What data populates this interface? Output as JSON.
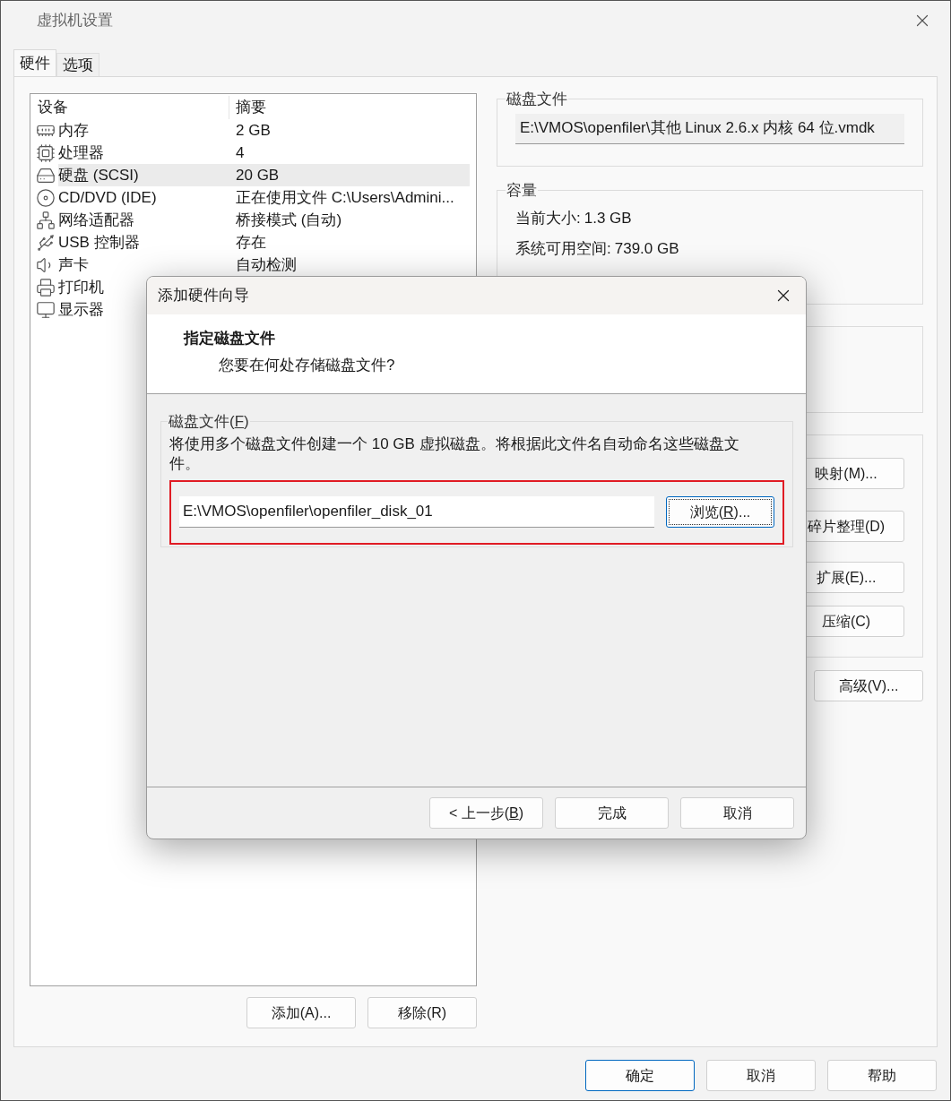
{
  "window": {
    "title": "虚拟机设置"
  },
  "tabs": [
    {
      "label": "硬件",
      "selected": true
    },
    {
      "label": "选项",
      "selected": false
    }
  ],
  "device_table": {
    "columns": [
      "设备",
      "摘要"
    ],
    "rows": [
      {
        "device": "内存",
        "summary": "2 GB",
        "selected": false
      },
      {
        "device": "处理器",
        "summary": "4",
        "selected": false
      },
      {
        "device": "硬盘 (SCSI)",
        "summary": "20 GB",
        "selected": true
      },
      {
        "device": "CD/DVD (IDE)",
        "summary": "正在使用文件 C:\\Users\\Admini...",
        "selected": false
      },
      {
        "device": "网络适配器",
        "summary": "桥接模式 (自动)",
        "selected": false
      },
      {
        "device": "USB 控制器",
        "summary": "存在",
        "selected": false
      },
      {
        "device": "声卡",
        "summary": "自动检测",
        "selected": false
      },
      {
        "device": "打印机",
        "selected": false
      },
      {
        "device": "显示器",
        "selected": false
      }
    ]
  },
  "device_buttons": [
    "添加(A)...",
    "移除(R)"
  ],
  "disk_file": {
    "title": "磁盘文件",
    "value": "E:\\VMOS\\openfiler\\其他 Linux 2.6.x 内核 64 位.vmdk"
  },
  "capacity": {
    "title": "容量",
    "items": [
      {
        "label": "当前大小:",
        "value": "1.3 GB"
      },
      {
        "label": "系统可用空间:",
        "value": "739.0 GB"
      }
    ]
  },
  "disk_buttons": [
    "映射(M)...",
    "碎片整理(D)",
    "扩展(E)...",
    "压缩(C)"
  ],
  "advanced_button": "高级(V)...",
  "footer_buttons": [
    {
      "label": "确定",
      "default": true
    },
    {
      "label": "取消",
      "default": false
    },
    {
      "label": "帮助",
      "default": false
    }
  ],
  "wizard": {
    "title": "添加硬件向导",
    "heading": "指定磁盘文件",
    "subheading": "您要在何处存储磁盘文件?",
    "group_label": {
      "before": "磁盘文件(",
      "underlined": "F",
      "after": ")"
    },
    "description": "将使用多个磁盘文件创建一个 10 GB 虚拟磁盘。将根据此文件名自动命名这些磁盘文件。",
    "file_row": {
      "highlighted": true,
      "value": "E:\\VMOS\\openfiler\\openfiler_disk_01",
      "browse": {
        "before": "浏览(",
        "underlined": "R",
        "after": ")..."
      }
    },
    "buttons": [
      {
        "before": "< 上一步(",
        "underlined": "B",
        "after": ")"
      },
      {
        "before": "完成"
      },
      {
        "before": "取消"
      }
    ]
  }
}
